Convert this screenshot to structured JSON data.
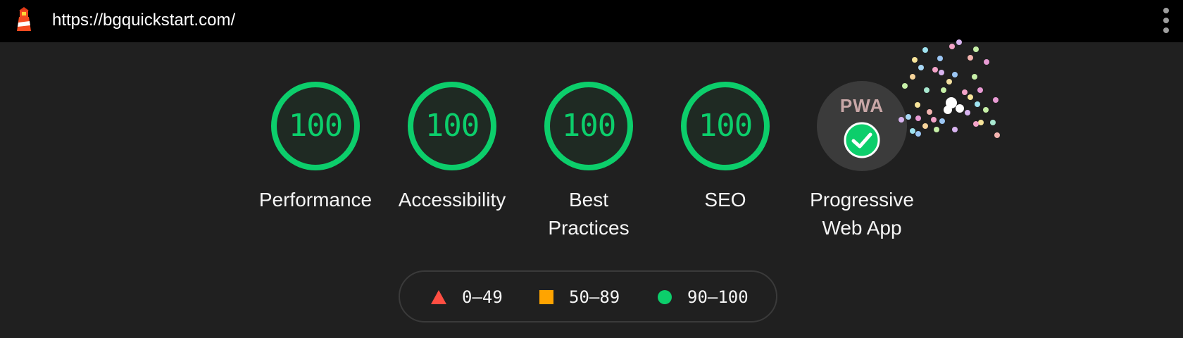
{
  "topbar": {
    "url": "https://bgquickstart.com/",
    "logo_icon": "lighthouse-icon",
    "menu_icon": "more-vertical-icon"
  },
  "gauges": [
    {
      "label": "Performance",
      "score": "100"
    },
    {
      "label": "Accessibility",
      "score": "100"
    },
    {
      "label_line1": "Best",
      "label_line2": "Practices",
      "score": "100"
    },
    {
      "label": "SEO",
      "score": "100"
    }
  ],
  "pwa": {
    "badge_text": "PWA",
    "label_line1": "Progressive",
    "label_line2": "Web App",
    "icon": "check-circle-icon"
  },
  "legend": [
    {
      "range": "0–49",
      "icon": "triangle-icon",
      "color": "#ff4e42"
    },
    {
      "range": "50–89",
      "icon": "square-icon",
      "color": "#ffa400"
    },
    {
      "range": "90–100",
      "icon": "circle-icon",
      "color": "#0cce6b"
    }
  ],
  "colors": {
    "pass": "#0cce6b",
    "background": "#202020",
    "topbar": "#000000"
  }
}
